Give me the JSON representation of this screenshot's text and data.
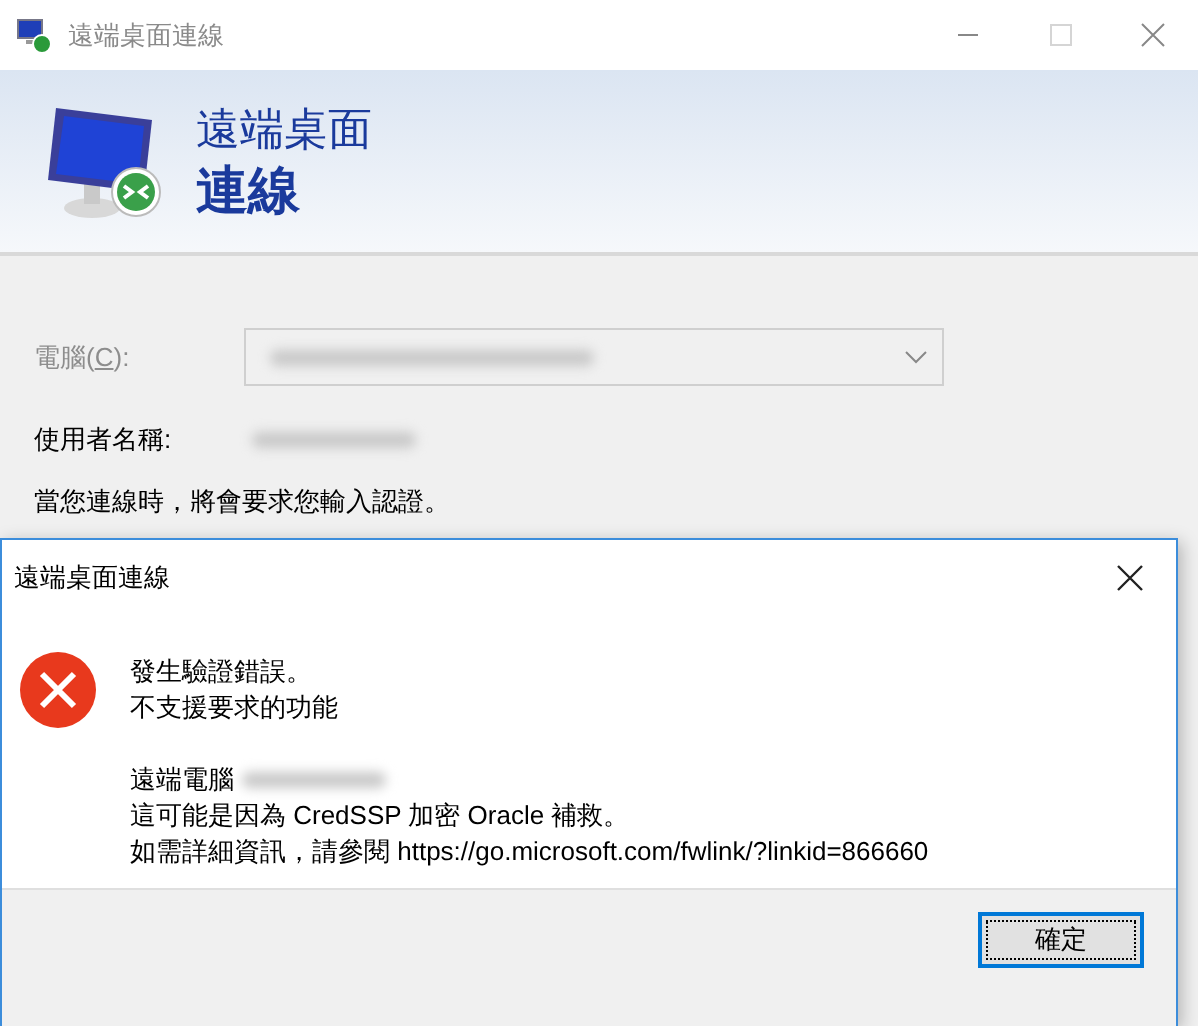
{
  "window": {
    "title": "遠端桌面連線",
    "active": false,
    "header": {
      "line_1": "遠端桌面",
      "line_2": "連線"
    },
    "form": {
      "computer_label_parts": [
        "電腦(",
        "C",
        "):"
      ],
      "computer_disabled": true,
      "user_label": "使用者名稱:",
      "note": "當您連線時，將會要求您輸入認證。"
    }
  },
  "dialog": {
    "title": "遠端桌面連線",
    "message_lines": [
      "發生驗證錯誤。",
      "不支援要求的功能"
    ],
    "remote_label": "遠端電腦",
    "detail_lines": [
      "這可能是因為 CredSSP 加密 Oracle 補救。",
      "如需詳細資訊，請參閱 https://go.microsoft.com/fwlink/?linkid=866660"
    ],
    "button": {
      "label": "確定",
      "default": true
    }
  }
}
